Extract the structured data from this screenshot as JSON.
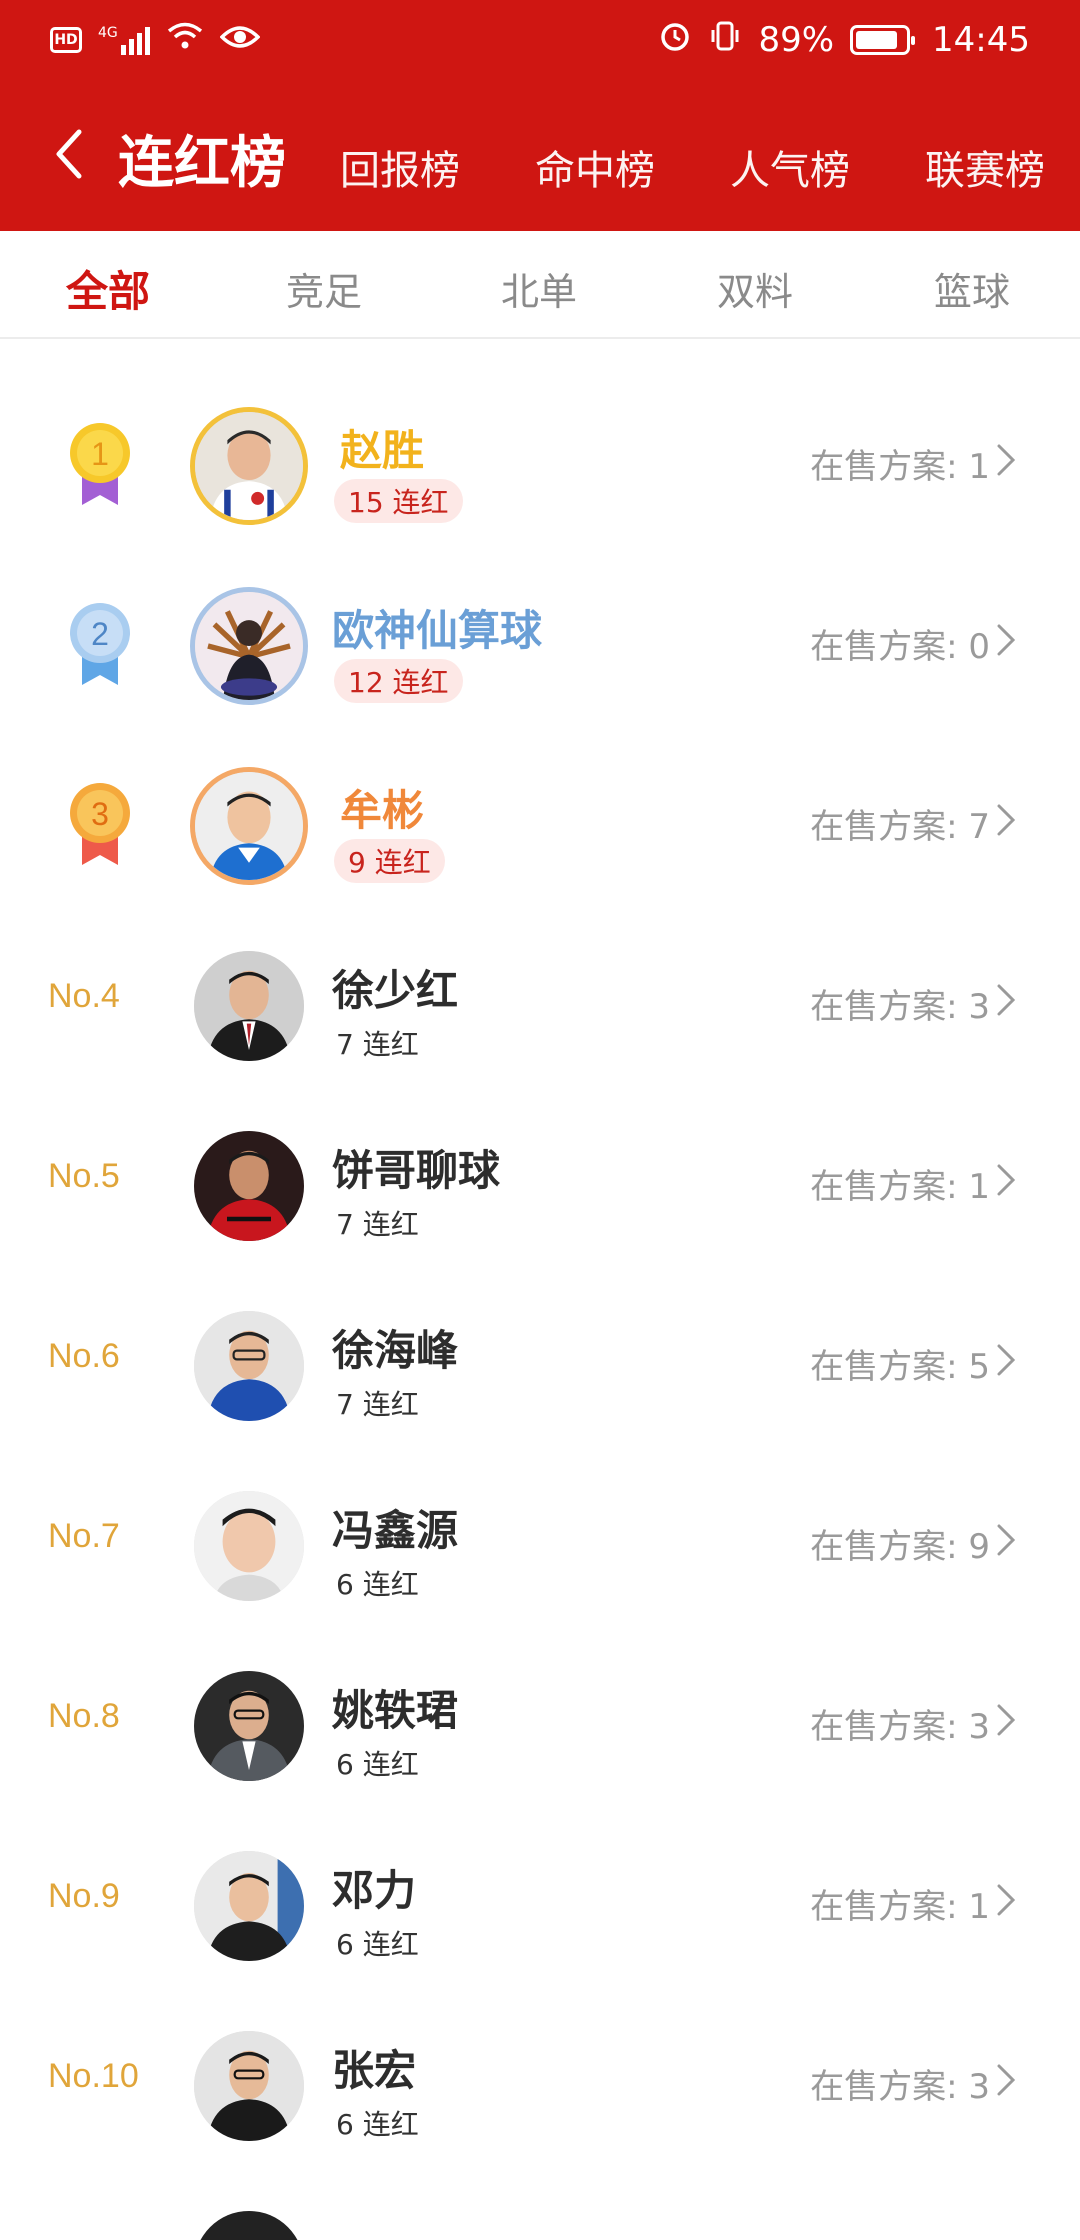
{
  "status_bar": {
    "left_badge": "HD",
    "network": "4G",
    "battery": "89%",
    "time": "14:45"
  },
  "header": {
    "title": "连红榜",
    "tabs": [
      "回报榜",
      "命中榜",
      "人气榜",
      "联赛榜"
    ]
  },
  "category_tabs": {
    "items": [
      "全部",
      "竞足",
      "北单",
      "双料",
      "篮球"
    ],
    "active_index": 0
  },
  "colors": {
    "brand_red": "#cf1612",
    "gold": "#f2b21c",
    "silver": "#6a9fd6",
    "bronze": "#f0883a",
    "rank_text": "#e0a53a"
  },
  "onsale_label": "在售方案:",
  "rankers": [
    {
      "rank": "1",
      "name": "赵胜",
      "streak": "15 连红",
      "onsale": "1",
      "medal": "gold"
    },
    {
      "rank": "2",
      "name": "欧神仙算球",
      "streak": "12 连红",
      "onsale": "0",
      "medal": "silver"
    },
    {
      "rank": "3",
      "name": "牟彬",
      "streak": "9 连红",
      "onsale": "7",
      "medal": "bronze"
    },
    {
      "rank": "No.4",
      "name": "徐少红",
      "streak": "7 连红",
      "onsale": "3"
    },
    {
      "rank": "No.5",
      "name": "饼哥聊球",
      "streak": "7 连红",
      "onsale": "1"
    },
    {
      "rank": "No.6",
      "name": "徐海峰",
      "streak": "7 连红",
      "onsale": "5"
    },
    {
      "rank": "No.7",
      "name": "冯鑫源",
      "streak": "6 连红",
      "onsale": "9"
    },
    {
      "rank": "No.8",
      "name": "姚轶珺",
      "streak": "6 连红",
      "onsale": "3"
    },
    {
      "rank": "No.9",
      "name": "邓力",
      "streak": "6 连红",
      "onsale": "1"
    },
    {
      "rank": "No.10",
      "name": "张宏",
      "streak": "6 连红",
      "onsale": "3"
    }
  ]
}
